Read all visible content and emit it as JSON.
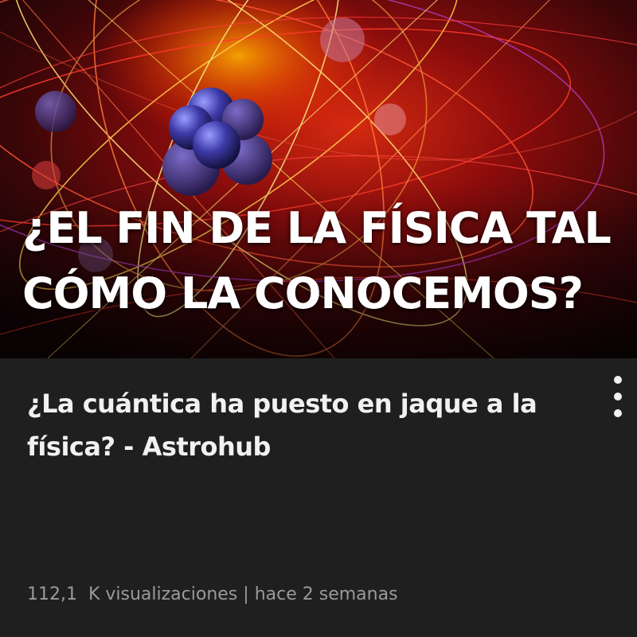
{
  "thumbnail": {
    "title_lines": [
      "¿EL FIN DE LA FÍSICA TAL",
      "CÓMO LA CONOCEMOS?"
    ]
  },
  "video": {
    "title": "¿La cuántica ha puesto en jaque a la física? - Astrohub",
    "views": "112,1  K visualizaciones",
    "separator": "|",
    "age": "hace 2 semanas"
  },
  "icons": {
    "more_menu": "more-vertical-icon"
  },
  "colors": {
    "background": "#1f1f1f",
    "title_text": "#f1f1f1",
    "meta_text": "#9a9a9a",
    "thumbnail_accent": "#e0201c"
  }
}
